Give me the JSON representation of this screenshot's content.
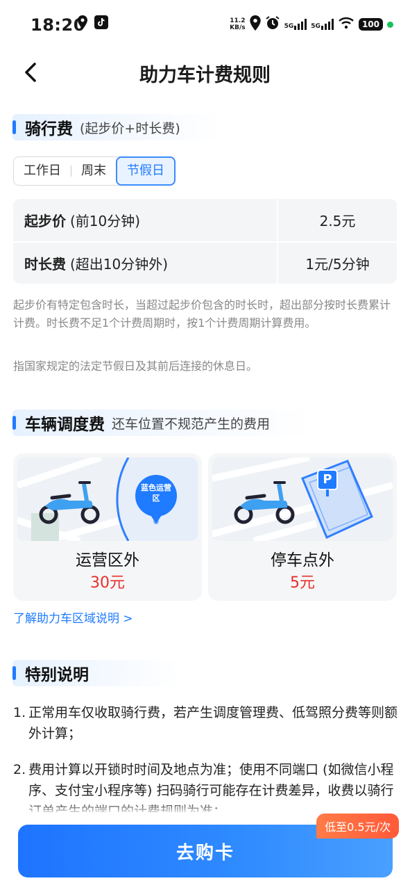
{
  "status_bar": {
    "time": "18:20",
    "net_speed_value": "11.2",
    "net_speed_unit": "KB/s",
    "signal1": "5G",
    "signal2": "5G",
    "battery": "100"
  },
  "nav": {
    "title": "助力车计费规则"
  },
  "riding_fee": {
    "title": "骑行费",
    "subtitle": "(起步价+时长费)",
    "tabs": [
      {
        "label": "工作日",
        "active": false
      },
      {
        "label": "周末",
        "active": false
      },
      {
        "label": "节假日",
        "active": true
      }
    ],
    "rows": [
      {
        "label": "起步价",
        "note": "(前10分钟)",
        "value": "2.5元"
      },
      {
        "label": "时长费",
        "note": "(超出10分钟外)",
        "value": "1元/5分钟"
      }
    ],
    "description": "起步价有特定包含时长，当超过起步价包含的时长时，超出部分按时长费累计计费。时长费不足1个计费周期时，按1个计费周期计算费用。",
    "holiday_note": "指国家规定的法定节假日及其前后连接的休息日。"
  },
  "dispatch_fee": {
    "title": "车辆调度费",
    "subtitle": "还车位置不规范产生的费用",
    "cards": [
      {
        "title": "运营区外",
        "price": "30元",
        "map_label": "蓝色运营区"
      },
      {
        "title": "停车点外",
        "price": "5元",
        "map_label": "P"
      }
    ],
    "link": "了解助力车区域说明 >"
  },
  "special_notes": {
    "title": "特别说明",
    "items": [
      {
        "num": "1.",
        "text": "正常用车仅收取骑行费，若产生调度管理费、低驾照分费等则额外计算；"
      },
      {
        "num": "2.",
        "text": "费用计算以开锁时时间及地点为准；使用不同端口 (如微信小程序、支付宝小程序等) 扫码骑行可能存在计费差异，收费以骑行订单产生的端口的计费规则为准；"
      }
    ]
  },
  "bottom": {
    "buy_label": "去购卡",
    "promo": "低至0.5元/次"
  },
  "colors": {
    "accent": "#1f7bff",
    "price_red": "#e8302a",
    "promo_orange": "#ff6a3d"
  }
}
